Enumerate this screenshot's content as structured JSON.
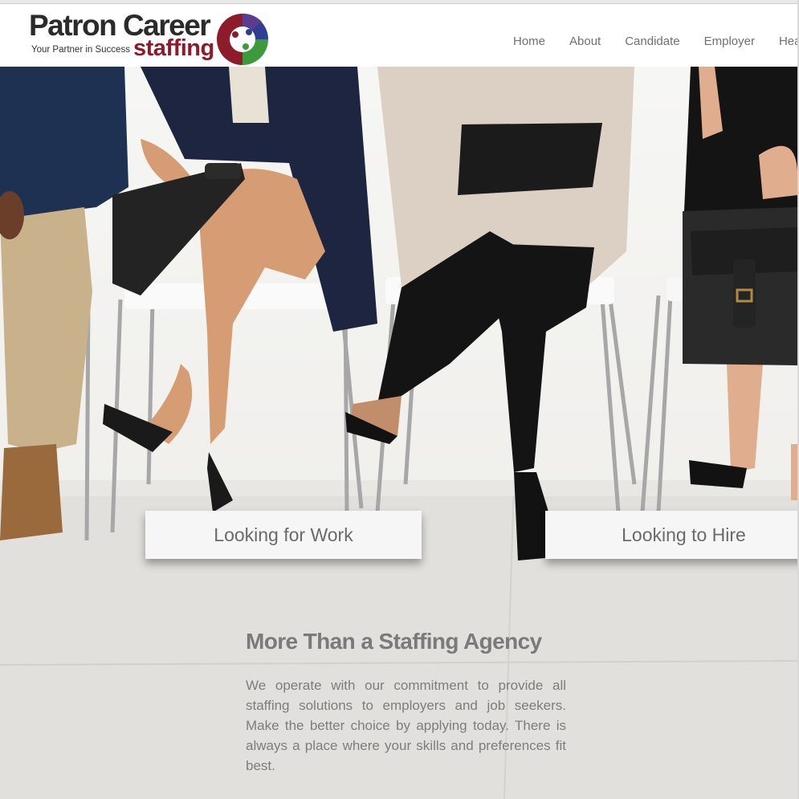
{
  "brand": {
    "name_line1": "Patron Career",
    "tagline": "Your Partner in Success",
    "name_line2": "staffing",
    "colors": {
      "dark": "#2b2b2b",
      "red": "#8e1b2a",
      "blue": "#2d3e93",
      "green": "#3c9a3b",
      "purple": "#5b3c8e"
    }
  },
  "nav": {
    "items": [
      "Home",
      "About",
      "Candidate",
      "Employer",
      "Hea"
    ]
  },
  "hero": {
    "cta_work": "Looking for Work",
    "cta_hire": "Looking to Hire"
  },
  "about": {
    "title": "More Than a Staffing Agency",
    "text": "We operate with our commitment to provide all staffing solutions to employers and job seekers. Make the better choice by applying today. There is always a place where your skills and preferences fit best."
  }
}
